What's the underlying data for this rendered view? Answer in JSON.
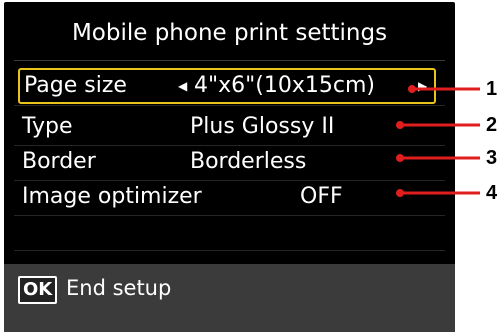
{
  "screen": {
    "title": "Mobile phone print settings",
    "settings": [
      {
        "label": "Page size",
        "value": "4\"x6\"(10x15cm)",
        "selected": true
      },
      {
        "label": "Type",
        "value": "Plus Glossy II",
        "selected": false
      },
      {
        "label": "Border",
        "value": "Borderless",
        "selected": false
      },
      {
        "label": "Image optimizer",
        "value": "OFF",
        "selected": false
      }
    ],
    "footer": {
      "ok_key": "OK",
      "action": "End setup"
    }
  },
  "callouts": [
    "1",
    "2",
    "3",
    "4"
  ],
  "colors": {
    "lcd_background": "#000000",
    "selection_border": "#e8c41a",
    "callout_line": "#e01e1e",
    "footer_background": "#3b3b3b"
  },
  "icons": {
    "left_arrow": "left-arrow-icon",
    "right_arrow": "right-arrow-icon"
  }
}
